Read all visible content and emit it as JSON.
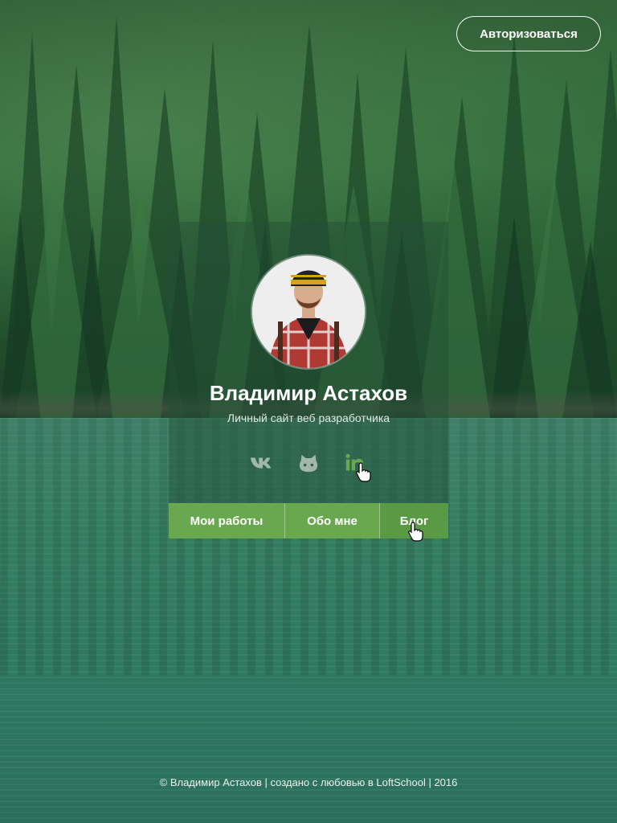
{
  "header": {
    "login_label": "Авторизоваться"
  },
  "profile": {
    "name": "Владимир Астахов",
    "subtitle": "Личный сайт веб разработчика",
    "avatar": "profile-photo"
  },
  "socials": [
    {
      "icon": "vk-icon"
    },
    {
      "icon": "github-icon"
    },
    {
      "icon": "linkedin-icon",
      "active_color": "#6aa84f"
    }
  ],
  "nav": {
    "items": [
      {
        "label": "Мои работы"
      },
      {
        "label": "Обо мне"
      },
      {
        "label": "Блог"
      }
    ],
    "color": "#6aa84f"
  },
  "footer": {
    "text": "© Владимир Астахов | создано с любовью в LoftSchool | 2016"
  }
}
